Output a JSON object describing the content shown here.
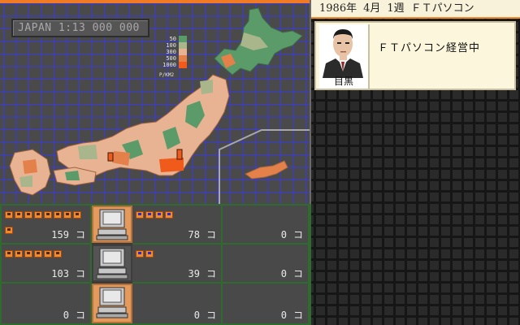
{
  "header": {
    "year": "1986年",
    "month": "4月",
    "week": "1週",
    "company": "ＦＴパソコン"
  },
  "map": {
    "scale_text": "JAPAN 1:13 000 000",
    "legend": {
      "labels": [
        "50",
        "100",
        "300",
        "500",
        "1000"
      ],
      "colors": [
        "#5b9b6a",
        "#a9b58a",
        "#e7b393",
        "#e4804a",
        "#f05a1a"
      ],
      "unit": "P/KM2"
    }
  },
  "manager": {
    "name": "目黒",
    "status": "ＦＴパソコン経営中"
  },
  "products": [
    {
      "count": "159",
      "unit": "コ",
      "icons": 9,
      "icon_style": "orange"
    },
    {
      "count": "78",
      "unit": "コ",
      "icons": 4,
      "icon_style": "blue"
    },
    {
      "count": "0",
      "unit": "コ",
      "icons": 0,
      "icon_style": "orange"
    },
    {
      "count": "103",
      "unit": "コ",
      "icons": 6,
      "icon_style": "orange"
    },
    {
      "count": "39",
      "unit": "コ",
      "icons": 2,
      "icon_style": "blue"
    },
    {
      "count": "0",
      "unit": "コ",
      "icons": 0,
      "icon_style": "orange"
    },
    {
      "count": "0",
      "unit": "コ",
      "icons": 0,
      "icon_style": "orange"
    },
    {
      "count": "0",
      "unit": "コ",
      "icons": 0,
      "icon_style": "orange"
    },
    {
      "count": "0",
      "unit": "コ",
      "icons": 0,
      "icon_style": "orange"
    }
  ]
}
